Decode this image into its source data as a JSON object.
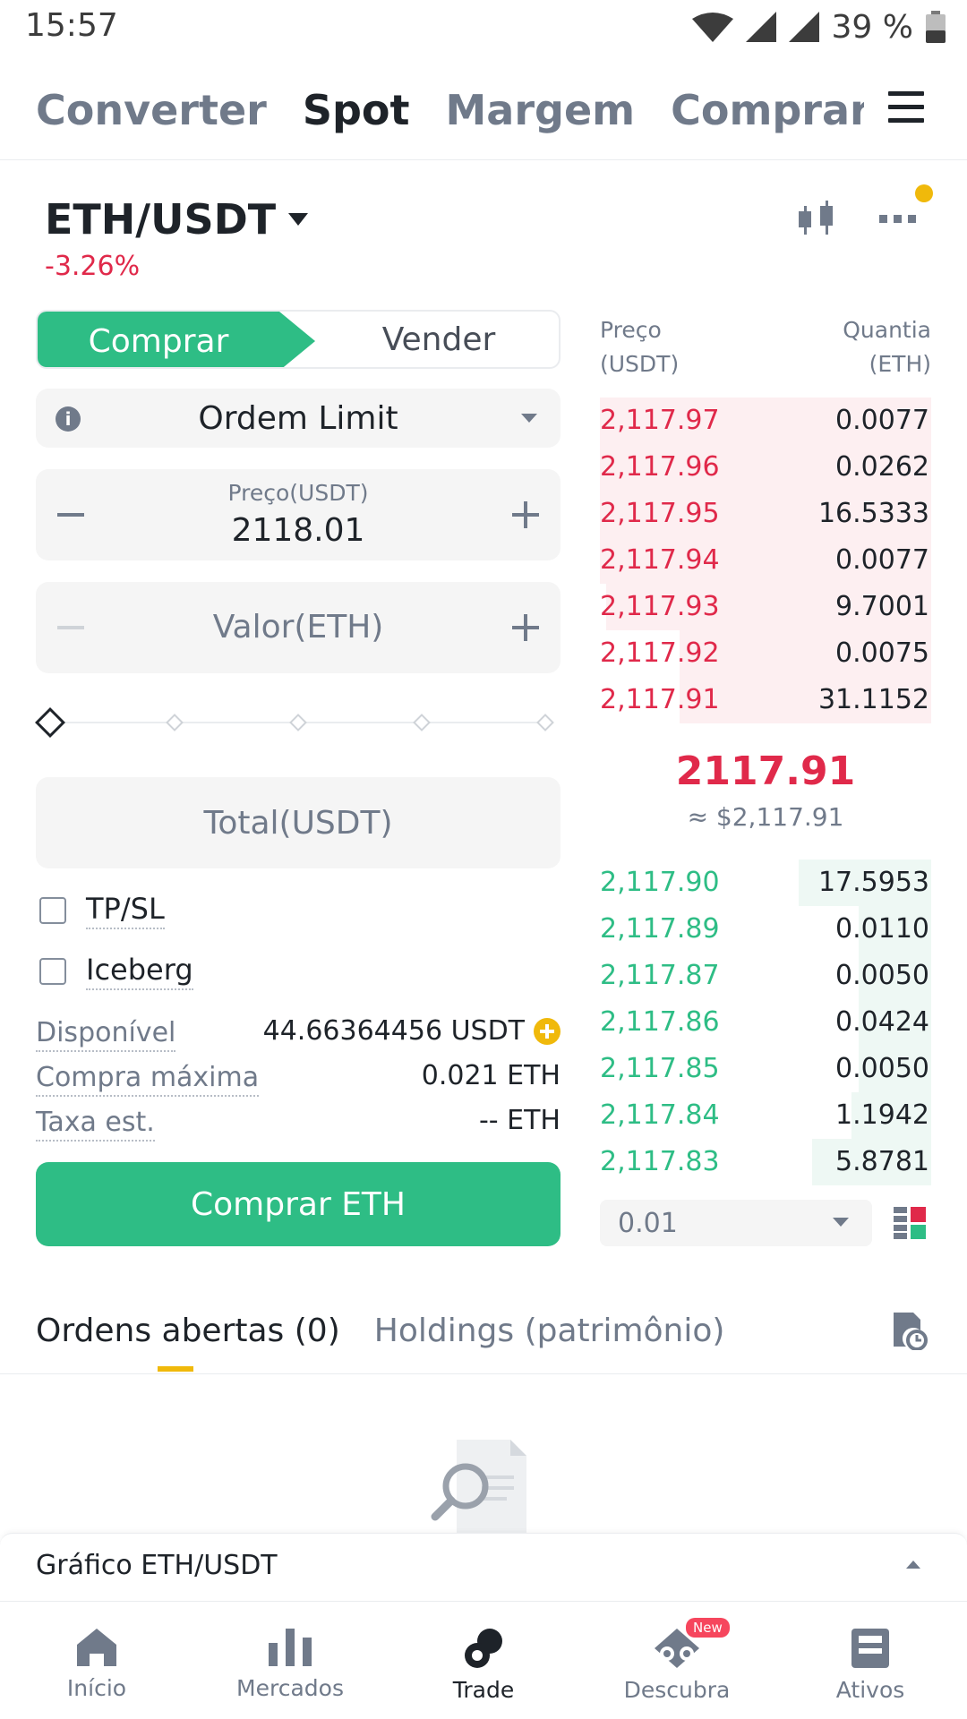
{
  "status": {
    "time": "15:57",
    "battery": "39 %"
  },
  "top_tabs": [
    {
      "label": "Converter",
      "active": false
    },
    {
      "label": "Spot",
      "active": true
    },
    {
      "label": "Margem",
      "active": false
    },
    {
      "label": "Comprar/Vend",
      "active": false
    }
  ],
  "pair": {
    "symbol": "ETH/USDT",
    "change": "-3.26%"
  },
  "trade": {
    "buy_label": "Comprar",
    "sell_label": "Vender",
    "order_type": "Ordem Limit",
    "price_label": "Preço(USDT)",
    "price_value": "2118.01",
    "amount_label": "Valor(ETH)",
    "total_label": "Total(USDT)",
    "tpsl_label": "TP/SL",
    "iceberg_label": "Iceberg",
    "available_label": "Disponível",
    "available_value": "44.66364456 USDT",
    "max_buy_label": "Compra máxima",
    "max_buy_value": "0.021 ETH",
    "fee_label": "Taxa est.",
    "fee_value": "-- ETH",
    "buy_button": "Comprar ETH"
  },
  "orderbook": {
    "price_header": "Preço",
    "price_unit": "(USDT)",
    "qty_header": "Quantia",
    "qty_unit": "(ETH)",
    "asks": [
      {
        "price": "2,117.97",
        "qty": "0.0077",
        "depth": 1.0
      },
      {
        "price": "2,117.96",
        "qty": "0.0262",
        "depth": 1.0
      },
      {
        "price": "2,117.95",
        "qty": "16.5333",
        "depth": 1.0
      },
      {
        "price": "2,117.94",
        "qty": "0.0077",
        "depth": 1.0
      },
      {
        "price": "2,117.93",
        "qty": "9.7001",
        "depth": 0.98
      },
      {
        "price": "2,117.92",
        "qty": "0.0075",
        "depth": 0.76
      },
      {
        "price": "2,117.91",
        "qty": "31.1152",
        "depth": 0.76
      }
    ],
    "mid_price": "2117.91",
    "mid_usd": "≈ $2,117.91",
    "bids": [
      {
        "price": "2,117.90",
        "qty": "17.5953",
        "depth": 0.4
      },
      {
        "price": "2,117.89",
        "qty": "0.0110",
        "depth": 0.22
      },
      {
        "price": "2,117.87",
        "qty": "0.0050",
        "depth": 0.22
      },
      {
        "price": "2,117.86",
        "qty": "0.0424",
        "depth": 0.22
      },
      {
        "price": "2,117.85",
        "qty": "0.0050",
        "depth": 0.22
      },
      {
        "price": "2,117.84",
        "qty": "1.1942",
        "depth": 0.24
      },
      {
        "price": "2,117.83",
        "qty": "5.8781",
        "depth": 0.36
      }
    ],
    "depth_value": "0.01"
  },
  "orders": {
    "open_tab": "Ordens abertas (0)",
    "holdings_tab": "Holdings (patrimônio)"
  },
  "chart_bar": {
    "label": "Gráfico ETH/USDT"
  },
  "bottom_nav": [
    {
      "label": "Início",
      "icon": "home-icon",
      "active": false
    },
    {
      "label": "Mercados",
      "icon": "markets-icon",
      "active": false
    },
    {
      "label": "Trade",
      "icon": "trade-icon",
      "active": true
    },
    {
      "label": "Descubra",
      "icon": "discover-icon",
      "active": false,
      "badge": "New"
    },
    {
      "label": "Ativos",
      "icon": "wallet-icon",
      "active": false
    }
  ],
  "colors": {
    "green": "#2ebd85",
    "red": "#e0294a",
    "yellow": "#f0b90b",
    "gray": "#707a8a"
  }
}
